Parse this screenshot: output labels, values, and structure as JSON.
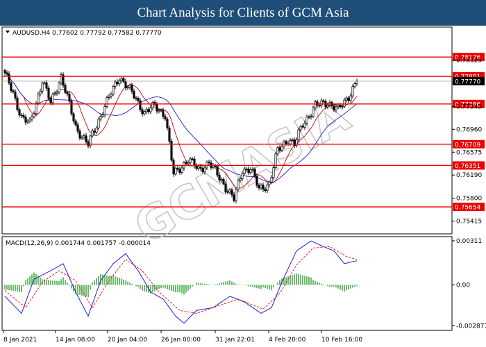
{
  "header": {
    "title": "Chart Analysis for Clients of GCM Asia"
  },
  "symbol_line": "AUDUSD,H4  0.77602 0.77792 0.77582 0.77770",
  "watermark": "GCMASIA",
  "colors": {
    "header_bg": "#1f4e79",
    "candle": "#000000",
    "ma_fast": "#cc0000",
    "ma_slow": "#1e1ed2",
    "level_line": "#ee0000",
    "level_label_bg": "#ee0000",
    "level_label_text": "#ffffff",
    "macd_line": "#1e1ed2",
    "signal_line": "#ee0000",
    "histogram": "#2e9e2e"
  },
  "chart_data": [
    {
      "type": "candlestick",
      "title": "AUDUSD,H4",
      "ylim": [
        0.752,
        0.7868
      ],
      "y_ticks": [
        "0.75415",
        "0.75800",
        "0.76190",
        "0.76575",
        "0.76960",
        "0.77345",
        "0.77735",
        "0.78125"
      ],
      "x_ticks": [
        "8 Jan 2021",
        "14 Jan 08:00",
        "20 Jan 04:00",
        "26 Jan 00:00",
        "31 Jan 22:01",
        "4 Feb 20:00",
        "10 Feb 16:00"
      ],
      "last_price": "0.77770",
      "horizontal_levels": [
        "0.78176",
        "0.77851",
        "0.77386",
        "0.76709",
        "0.76351",
        "0.75654"
      ],
      "anchors": [
        {
          "i": 0,
          "v": 0.7788
        },
        {
          "i": 4,
          "v": 0.7758
        },
        {
          "i": 8,
          "v": 0.7715
        },
        {
          "i": 12,
          "v": 0.7705
        },
        {
          "i": 18,
          "v": 0.7778
        },
        {
          "i": 22,
          "v": 0.774
        },
        {
          "i": 27,
          "v": 0.7785
        },
        {
          "i": 34,
          "v": 0.77
        },
        {
          "i": 40,
          "v": 0.767
        },
        {
          "i": 47,
          "v": 0.7728
        },
        {
          "i": 55,
          "v": 0.7785
        },
        {
          "i": 62,
          "v": 0.7752
        },
        {
          "i": 67,
          "v": 0.7724
        },
        {
          "i": 72,
          "v": 0.7735
        },
        {
          "i": 77,
          "v": 0.772
        },
        {
          "i": 81,
          "v": 0.762
        },
        {
          "i": 88,
          "v": 0.7645
        },
        {
          "i": 93,
          "v": 0.7628
        },
        {
          "i": 98,
          "v": 0.764
        },
        {
          "i": 103,
          "v": 0.7615
        },
        {
          "i": 110,
          "v": 0.7578
        },
        {
          "i": 114,
          "v": 0.7628
        },
        {
          "i": 118,
          "v": 0.763
        },
        {
          "i": 122,
          "v": 0.7595
        },
        {
          "i": 127,
          "v": 0.7605
        },
        {
          "i": 131,
          "v": 0.766
        },
        {
          "i": 136,
          "v": 0.768
        },
        {
          "i": 139,
          "v": 0.767
        },
        {
          "i": 143,
          "v": 0.7705
        },
        {
          "i": 149,
          "v": 0.7735
        },
        {
          "i": 155,
          "v": 0.7742
        },
        {
          "i": 160,
          "v": 0.7728
        },
        {
          "i": 165,
          "v": 0.7752
        },
        {
          "i": 169,
          "v": 0.7777
        }
      ]
    },
    {
      "type": "line",
      "title": "MACD(12,26,9)",
      "header_values": "MACD(12,26,9) 0.001744 0.001757 -0.000014",
      "ylim": [
        -0.0032,
        0.0034
      ],
      "y_ticks": [
        "0.00311",
        "0.00",
        "-0.002877"
      ],
      "series": [
        {
          "name": "MACD",
          "anchors": [
            {
              "i": 0,
              "v": -0.0008
            },
            {
              "i": 8,
              "v": -0.002
            },
            {
              "i": 14,
              "v": 0.0004
            },
            {
              "i": 22,
              "v": 0.001
            },
            {
              "i": 28,
              "v": 0.0015
            },
            {
              "i": 34,
              "v": -0.0005
            },
            {
              "i": 40,
              "v": -0.0022
            },
            {
              "i": 46,
              "v": 0.0003
            },
            {
              "i": 52,
              "v": 0.0015
            },
            {
              "i": 58,
              "v": 0.0022
            },
            {
              "i": 64,
              "v": 0.001
            },
            {
              "i": 70,
              "v": -0.0005
            },
            {
              "i": 76,
              "v": -0.001
            },
            {
              "i": 82,
              "v": -0.0022
            },
            {
              "i": 86,
              "v": -0.0027
            },
            {
              "i": 92,
              "v": -0.0018
            },
            {
              "i": 100,
              "v": -0.0016
            },
            {
              "i": 108,
              "v": -0.0008
            },
            {
              "i": 115,
              "v": -0.0012
            },
            {
              "i": 123,
              "v": -0.002
            },
            {
              "i": 128,
              "v": -0.0016
            },
            {
              "i": 133,
              "v": 0.0002
            },
            {
              "i": 140,
              "v": 0.0024
            },
            {
              "i": 147,
              "v": 0.0031
            },
            {
              "i": 153,
              "v": 0.0027
            },
            {
              "i": 158,
              "v": 0.0024
            },
            {
              "i": 163,
              "v": 0.0015
            },
            {
              "i": 169,
              "v": 0.0017
            }
          ]
        },
        {
          "name": "Signal",
          "anchors": [
            {
              "i": 0,
              "v": -0.0004
            },
            {
              "i": 10,
              "v": -0.0016
            },
            {
              "i": 18,
              "v": 0.0002
            },
            {
              "i": 26,
              "v": 0.001
            },
            {
              "i": 34,
              "v": 0.0003
            },
            {
              "i": 42,
              "v": -0.0016
            },
            {
              "i": 50,
              "v": 0.0003
            },
            {
              "i": 58,
              "v": 0.0018
            },
            {
              "i": 66,
              "v": 0.001
            },
            {
              "i": 74,
              "v": -0.0005
            },
            {
              "i": 84,
              "v": -0.0018
            },
            {
              "i": 92,
              "v": -0.002
            },
            {
              "i": 102,
              "v": -0.0015
            },
            {
              "i": 112,
              "v": -0.001
            },
            {
              "i": 124,
              "v": -0.0017
            },
            {
              "i": 132,
              "v": -0.0006
            },
            {
              "i": 140,
              "v": 0.0014
            },
            {
              "i": 148,
              "v": 0.0026
            },
            {
              "i": 156,
              "v": 0.0027
            },
            {
              "i": 164,
              "v": 0.002
            },
            {
              "i": 169,
              "v": 0.0018
            }
          ]
        }
      ]
    }
  ]
}
